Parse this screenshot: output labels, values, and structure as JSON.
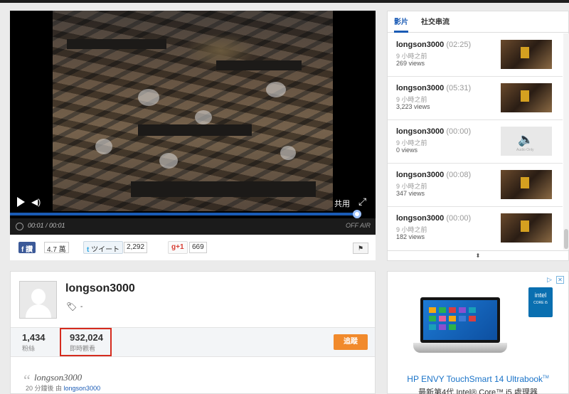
{
  "player": {
    "time": "00:01 / 00:01",
    "offair": "OFF AIR",
    "share_label": "共用",
    "progress": 0.95
  },
  "share": {
    "fb_label": "讚",
    "fb_count": "4.7 萬",
    "tweet_label": "ツイート",
    "tweet_count": "2,292",
    "gplus_label": "g+1",
    "gplus_count": "669"
  },
  "sidebar": {
    "tabs": [
      "影片",
      "社交串流"
    ],
    "active_tab": "影片",
    "items": [
      {
        "title": "longson3000",
        "duration": "(02:25)",
        "ago": "9 小時之前",
        "views": "269 views"
      },
      {
        "title": "longson3000",
        "duration": "(05:31)",
        "ago": "9 小時之前",
        "views": "3,223 views"
      },
      {
        "title": "longson3000",
        "duration": "(00:00)",
        "ago": "9 小時之前",
        "views": "0 views",
        "thumb_label": "Audio Only"
      },
      {
        "title": "longson3000",
        "duration": "(00:08)",
        "ago": "9 小時之前",
        "views": "347 views"
      },
      {
        "title": "longson3000",
        "duration": "(00:00)",
        "ago": "9 小時之前",
        "views": "182 views"
      }
    ]
  },
  "channel": {
    "name": "longson3000",
    "tag": "-",
    "followers": "1,434",
    "followers_label": "粉絲",
    "views": "932,024",
    "views_label": "即時觀看",
    "follow_label": "追蹤",
    "quote_name": "longson3000",
    "quote_meta_prefix": "20 分鐘後 由",
    "quote_meta_link": "longson3000"
  },
  "ad": {
    "intel_label": "intel",
    "intel_sub": "CORE i5",
    "title": "HP ENVY TouchSmart 14 Ultrabook",
    "title_tm": "TM",
    "subtitle": "最新第4代 Intel® Core™ i5 處理器"
  },
  "colors": {
    "accent": "#1a5bb5",
    "follow": "#f18a2c",
    "highlight": "#d52b1e"
  }
}
